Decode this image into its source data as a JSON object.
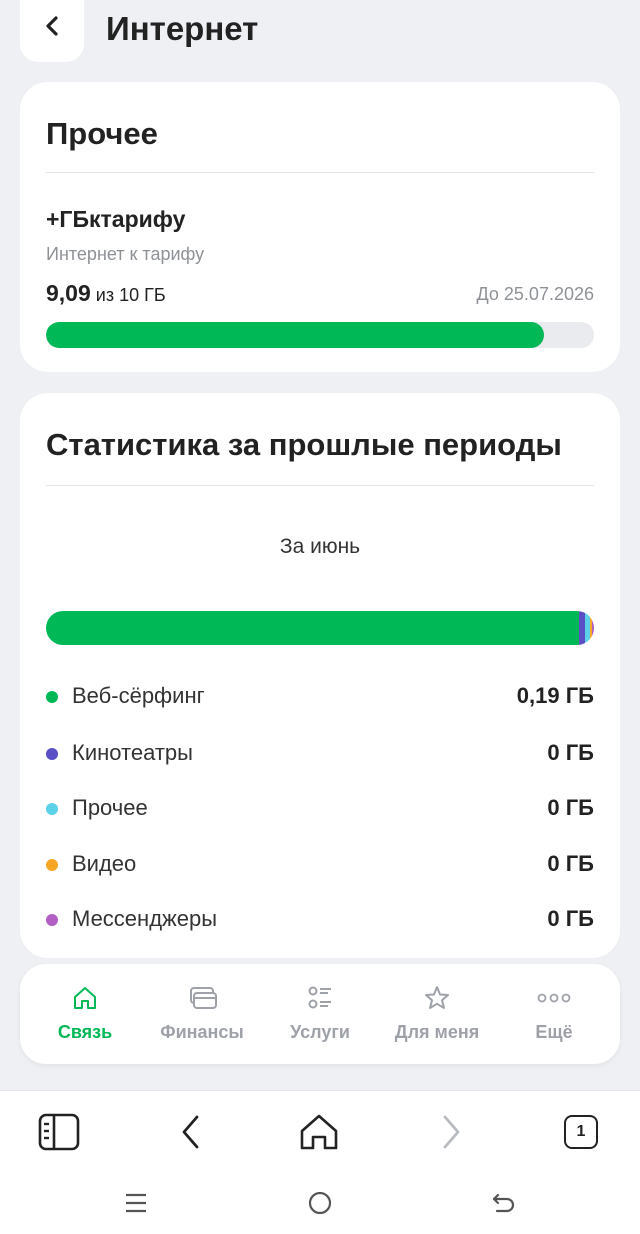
{
  "header": {
    "title": "Интернет"
  },
  "other_card": {
    "title": "Прочее",
    "package": {
      "name": "+ГБктарифу",
      "subtitle": "Интернет к тарифу",
      "used": "9,09",
      "total_text": "из 10 ГБ",
      "until": "До 25.07.2026",
      "progress_fraction": 0.909
    }
  },
  "stats_card": {
    "title": "Статистика за прошлые периоды",
    "period": "За июнь",
    "segments": [
      {
        "share": 0.972,
        "color": "#00b956"
      },
      {
        "share": 0.012,
        "color": "#5a4fc4"
      },
      {
        "share": 0.009,
        "color": "#5ad1e6"
      },
      {
        "share": 0.004,
        "color": "#f6a623"
      },
      {
        "share": 0.003,
        "color": "#b25ec4"
      }
    ],
    "legend": [
      {
        "label": "Веб-сёрфинг",
        "value": "0,19 ГБ",
        "color": "#00b956"
      },
      {
        "label": "Кинотеатры",
        "value": "0 ГБ",
        "color": "#5a4fc4"
      },
      {
        "label": "Прочее",
        "value": "0 ГБ",
        "color": "#5ad1e6"
      },
      {
        "label": "Видео",
        "value": "0 ГБ",
        "color": "#f6a623"
      },
      {
        "label": "Мессенджеры",
        "value": "0 ГБ",
        "color": "#b25ec4"
      }
    ]
  },
  "tabbar": {
    "tabs": [
      {
        "label": "Связь",
        "icon": "home-icon",
        "active": true
      },
      {
        "label": "Финансы",
        "icon": "cards-icon",
        "active": false
      },
      {
        "label": "Услуги",
        "icon": "services-list-icon",
        "active": false
      },
      {
        "label": "Для меня",
        "icon": "star-icon",
        "active": false
      },
      {
        "label": "Ещё",
        "icon": "more-dots-icon",
        "active": false
      }
    ]
  },
  "browser": {
    "tab_count": "1"
  },
  "colors": {
    "accent": "#00b956",
    "inactive": "#9ea2a8",
    "background": "#eef0f3"
  }
}
